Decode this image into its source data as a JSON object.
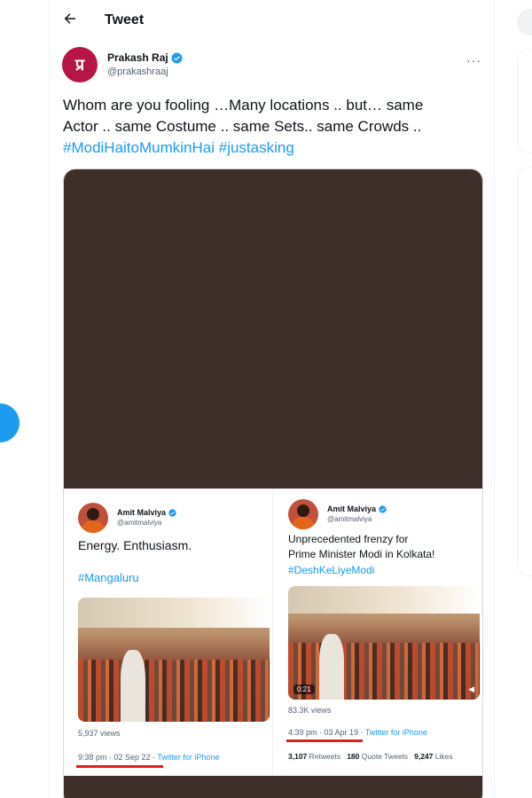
{
  "header": {
    "title": "Tweet",
    "back_icon": "arrow-left-icon"
  },
  "author": {
    "name": "Prakash Raj",
    "handle": "@prakashraaj",
    "avatar_letter": "प्र",
    "avatar_color": "#b71447",
    "verified": true
  },
  "tweet": {
    "line1": "Whom are you fooling …Many locations .. but… same",
    "line2": "Actor .. same Costume .. same Sets.. same Crowds  ..",
    "hashtag1": "#ModiHaitoMumkinHai",
    "hashtag2": "#justasking"
  },
  "embedded": {
    "left": {
      "name": "Amit Malviya",
      "handle": "@amitmalviya",
      "text": "Energy. Enthusiasm.",
      "hashtag": "#Mangaluru",
      "views": "5,937 views",
      "timestamp": "9:38 pm · 02 Sep 22 · ",
      "source": "Twitter for iPhone"
    },
    "right": {
      "name": "Amit Malviya",
      "handle": "@amitmalviya",
      "text_line1": "Unprecedented frenzy for",
      "text_line2": "Prime Minister Modi in Kolkata!",
      "hashtag": "#DeshKeLiyeModi",
      "video_time": "0:21",
      "views": "83.3K views",
      "timestamp": "4:39 pm · 03 Apr 19 · ",
      "source": "Twitter for iPhone",
      "retweets_count": "3,107",
      "retweets_label": "Retweets",
      "quotes_count": "180",
      "quotes_label": "Quote Tweets",
      "likes_count": "9,247",
      "likes_label": "Likes"
    }
  },
  "colors": {
    "accent": "#1d9bf0",
    "underline": "#e0201b",
    "media_bg": "#3f2f2b"
  }
}
